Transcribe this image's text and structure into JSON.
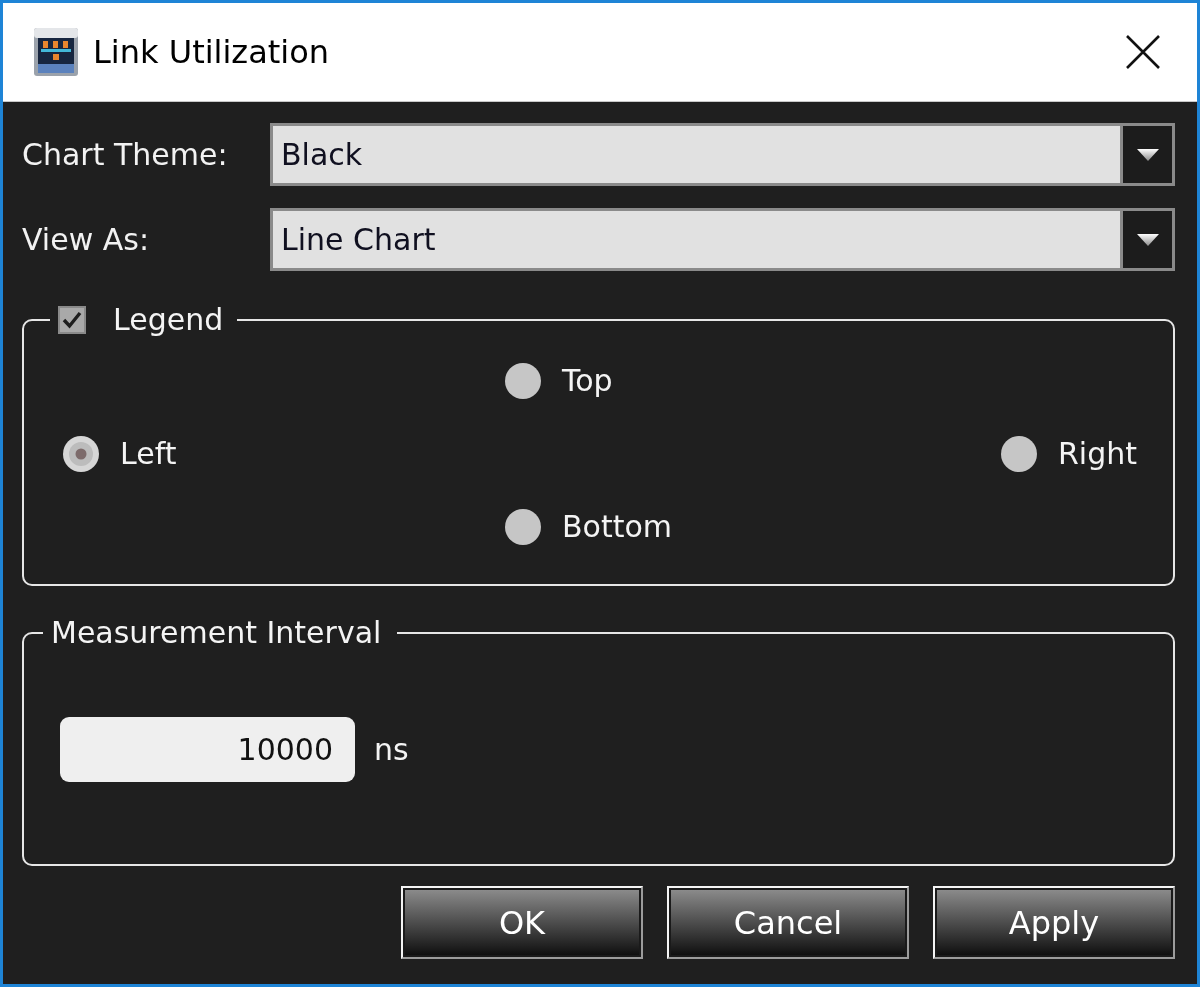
{
  "window": {
    "title": "Link Utilization"
  },
  "fields": [
    {
      "label": "Chart Theme:",
      "value": "Black"
    },
    {
      "label": "View As:",
      "value": "Line Chart"
    }
  ],
  "legend": {
    "label": "Legend",
    "checked": true,
    "positions": [
      {
        "label": "Top",
        "selected": false
      },
      {
        "label": "Left",
        "selected": true
      },
      {
        "label": "Right",
        "selected": false
      },
      {
        "label": "Bottom",
        "selected": false
      }
    ]
  },
  "measurement_interval": {
    "title": "Measurement Interval",
    "value": "10000",
    "unit": "ns"
  },
  "buttons": [
    "OK",
    "Cancel",
    "Apply"
  ]
}
